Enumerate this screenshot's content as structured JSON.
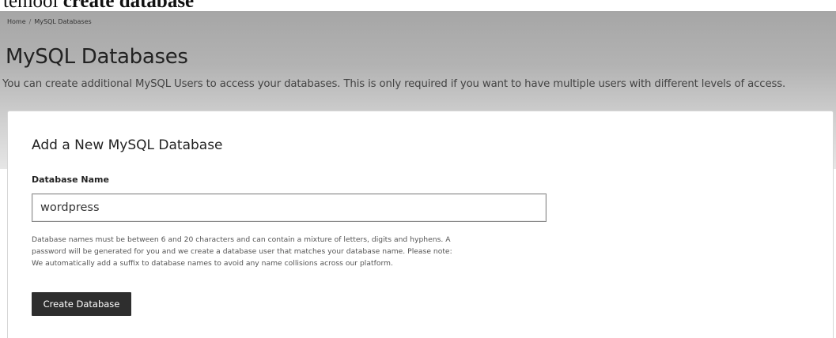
{
  "top_strip": {
    "text_light": "temool ",
    "text_bold": "create database"
  },
  "breadcrumb": {
    "home": "Home",
    "separator": "/",
    "current": "MySQL Databases"
  },
  "page": {
    "title": "MySQL Databases",
    "description": "You can create additional MySQL Users to access your databases. This is only required if you want to have multiple users with different levels of access."
  },
  "form": {
    "title": "Add a New MySQL Database",
    "db_name_label": "Database Name",
    "db_name_value": "wordpress",
    "help_lines": [
      "Database names must be between 6 and 20 characters and can contain a mixture of letters, digits and hyphens. A",
      "password will be generated for you and we create a database user that matches your database name. Please note:",
      "We automatically add a suffix to database names to avoid any name collisions across our platform."
    ],
    "submit_label": "Create Database"
  },
  "colors": {
    "header_band": "#b3b3b3",
    "button_bg": "#2e2e2e",
    "button_text": "#ffffff",
    "card_border": "#d6d6d6"
  }
}
